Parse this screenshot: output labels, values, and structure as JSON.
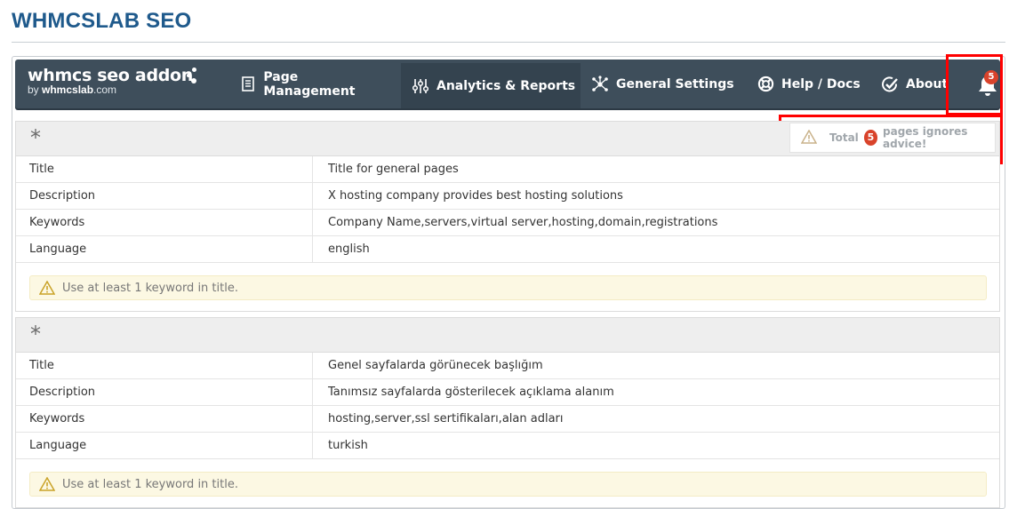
{
  "page": {
    "title": "WHMCSLAB SEO"
  },
  "brand": {
    "name": "whmcs seo addon",
    "by_prefix": "by ",
    "by_strong": "whmcslab",
    "by_suffix": ".com"
  },
  "nav": {
    "items": [
      {
        "label": "Page Management",
        "icon": "document-list-icon"
      },
      {
        "label": "Analytics & Reports",
        "icon": "sliders-icon"
      },
      {
        "label": "General Settings",
        "icon": "network-icon"
      },
      {
        "label": "Help / Docs",
        "icon": "lifebuoy-icon"
      },
      {
        "label": "About",
        "icon": "check-circle-icon"
      }
    ],
    "notification_count": "5"
  },
  "notification_tip": {
    "prefix": "Total",
    "count": "5",
    "suffix": "pages ignores advice!"
  },
  "panels": [
    {
      "heading": "*",
      "rows": [
        {
          "key": "Title",
          "value": "Title for general pages"
        },
        {
          "key": "Description",
          "value": "X hosting company provides best hosting solutions"
        },
        {
          "key": "Keywords",
          "value": "Company Name,servers,virtual server,hosting,domain,registrations"
        },
        {
          "key": "Language",
          "value": "english"
        }
      ],
      "warning": "Use at least 1 keyword in title."
    },
    {
      "heading": "*",
      "rows": [
        {
          "key": "Title",
          "value": "Genel sayfalarda görünecek başlığım"
        },
        {
          "key": "Description",
          "value": "Tanımsız sayfalarda gösterilecek açıklama alanım"
        },
        {
          "key": "Keywords",
          "value": "hosting,server,ssl sertifikaları,alan adları"
        },
        {
          "key": "Language",
          "value": "turkish"
        }
      ],
      "warning": "Use at least 1 keyword in title."
    }
  ],
  "colors": {
    "title": "#1f5a8c",
    "navbar": "#3e4e5b",
    "badge": "#d9432b",
    "annotation": "#ff0000",
    "warning_bg": "#fcf8e3"
  }
}
